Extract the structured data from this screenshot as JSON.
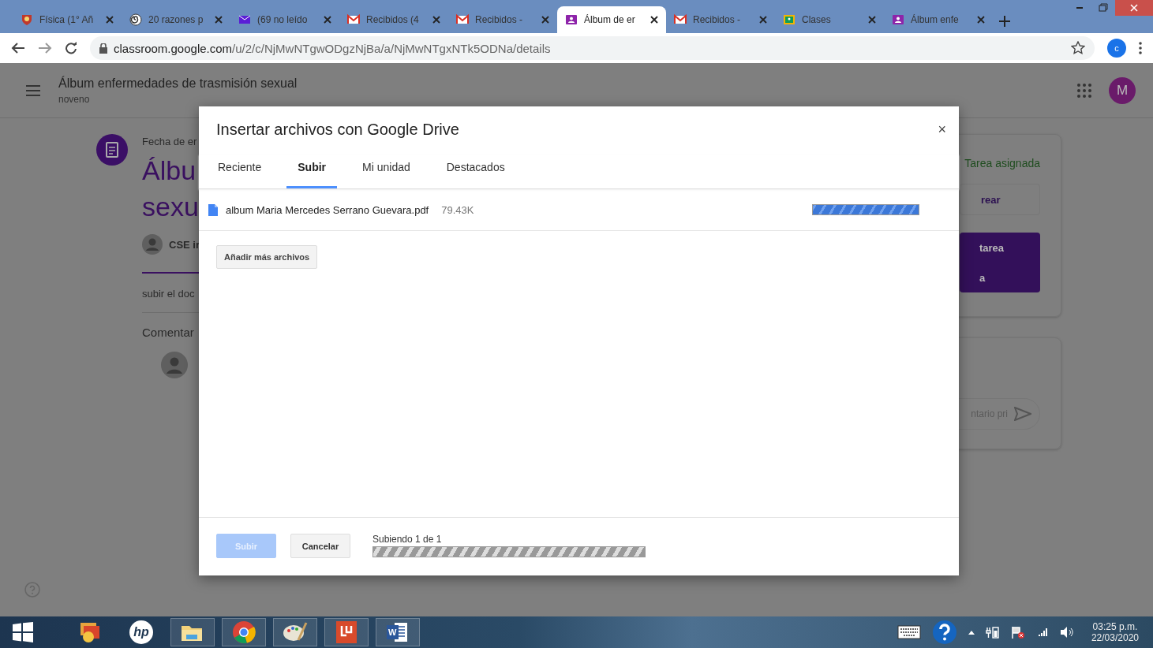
{
  "browser": {
    "tabs": [
      {
        "label": "Física (1° Añ",
        "kind": "shield",
        "selected": false
      },
      {
        "label": "20 razones p",
        "kind": "spiral",
        "selected": false
      },
      {
        "label": "(69 no leído",
        "kind": "mail",
        "selected": false
      },
      {
        "label": "Recibidos (4",
        "kind": "gmail",
        "selected": false
      },
      {
        "label": "Recibidos -",
        "kind": "gmail",
        "selected": false
      },
      {
        "label": "Álbum de er",
        "kind": "classroom",
        "selected": true
      },
      {
        "label": "Recibidos -",
        "kind": "gmail",
        "selected": false
      },
      {
        "label": "Clases",
        "kind": "classes",
        "selected": false
      },
      {
        "label": "Álbum enfe",
        "kind": "classroom",
        "selected": false
      }
    ],
    "url_host": "classroom.google.com",
    "url_path": "/u/2/c/NjMwNTgwODgzNjBa/a/NjMwNTgxNTk5ODNa/details",
    "profile_initial": "c"
  },
  "page": {
    "title": "Álbum enfermedades de trasmisión sexual",
    "subtitle": "noveno",
    "avatar_initial": "M",
    "due": "Fecha de er",
    "heading_lines": [
      "Álbu",
      "sexu"
    ],
    "author": "CSE ir",
    "instructions": "subir el doc",
    "comments": "Comentar",
    "work_card": {
      "status": "Tarea asignada",
      "create": "rear",
      "submit_lines": [
        "tarea",
        "a"
      ]
    },
    "private_comment": "ntario pri"
  },
  "dialog": {
    "title": "Insertar archivos con Google Drive",
    "close": "×",
    "tabs": [
      {
        "label": "Reciente",
        "selected": false
      },
      {
        "label": "Subir",
        "selected": true
      },
      {
        "label": "Mi unidad",
        "selected": false
      },
      {
        "label": "Destacados",
        "selected": false
      }
    ],
    "files": [
      {
        "name": "album Maria Mercedes Serrano Guevara.pdf",
        "size": "79.43K",
        "level": 1
      }
    ],
    "add_more": "Añadir más archivos",
    "buttons": [
      {
        "label": "Subir",
        "kind": "primary",
        "disabled": true
      },
      {
        "label": "Cancelar",
        "kind": "secondary",
        "disabled": false
      }
    ],
    "status": "Subiendo 1 de 1",
    "level": 1
  },
  "taskbar": {
    "apps": [
      {
        "kind": "photos"
      },
      {
        "kind": "hp",
        "glyph": "hp"
      },
      {
        "kind": "folder"
      },
      {
        "kind": "chrome"
      },
      {
        "kind": "paint"
      },
      {
        "kind": "acrobat"
      },
      {
        "kind": "word",
        "glyph": "W"
      }
    ],
    "time": "03:25 p.m.",
    "date": "22/03/2020"
  }
}
